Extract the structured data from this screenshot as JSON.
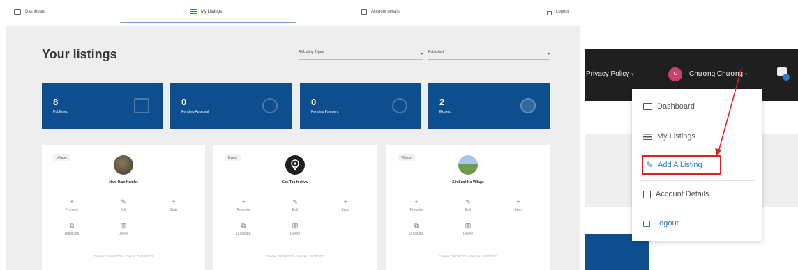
{
  "nav": {
    "dashboard": "Dashboard",
    "my_listings": "My Listings",
    "account_details": "Account details",
    "logout": "Logout"
  },
  "page": {
    "title": "Your listings",
    "filter_type": "All Listing Types",
    "filter_status": "Published"
  },
  "stats": [
    {
      "value": "8",
      "label": "Published"
    },
    {
      "value": "0",
      "label": "Pending Approval"
    },
    {
      "value": "0",
      "label": "Pending Payment"
    },
    {
      "value": "2",
      "label": "Expired"
    }
  ],
  "cards": [
    {
      "badge": "Village",
      "title": "Nam Dam Hamlet",
      "dates": "Created: 22/09/2022 · Expires: 22/10/2022"
    },
    {
      "badge": "Event",
      "title": "Gau Tao festival",
      "dates": "Created: 26/09/2022 · Expires: 26/10/2022"
    },
    {
      "badge": "Village",
      "title": "Sin Suoi Ho Village",
      "dates": "Created: 26/09/2022 · Expires: 26/10/2022"
    }
  ],
  "actions": {
    "promote": "Promote",
    "edit": "Edit",
    "stats": "Stats",
    "duplicate": "Duplicate",
    "delete": "Delete"
  },
  "header": {
    "privacy": "Privacy Policy",
    "avatar_initial": "C",
    "username": "Chương Chương"
  },
  "dropdown": {
    "dashboard": "Dashboard",
    "my_listings": "My Listings",
    "add_listing": "Add A Listing",
    "account_details": "Account Details",
    "logout": "Logout"
  },
  "colors": {
    "brand_blue": "#0d4e8e",
    "link_blue": "#2d7cc8",
    "highlight_red": "#d42424"
  }
}
